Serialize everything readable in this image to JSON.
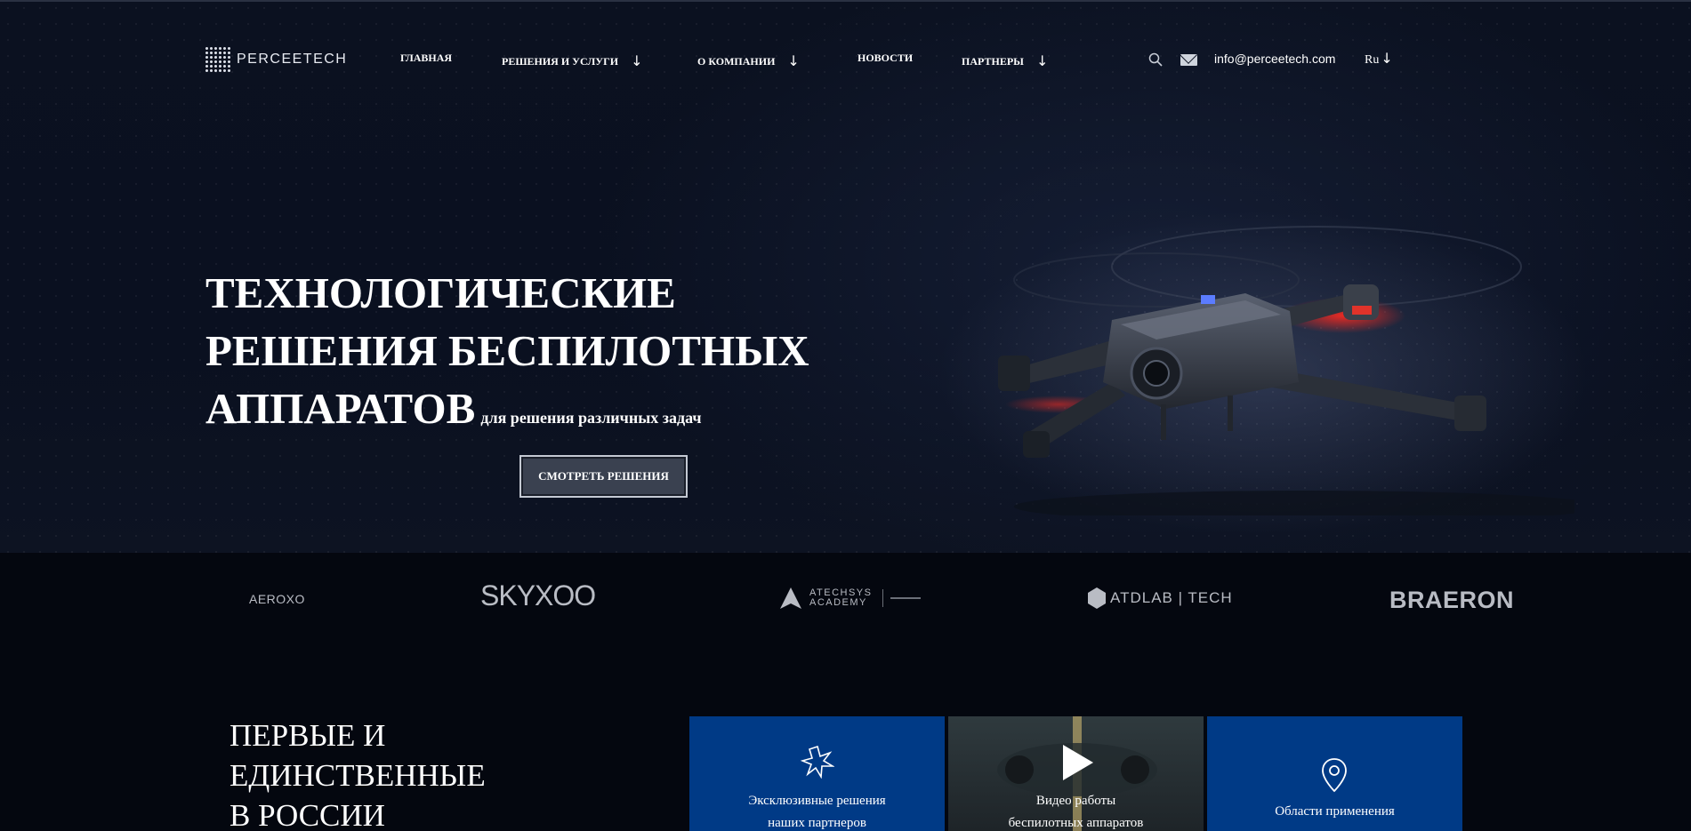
{
  "brand": {
    "name": "PERCEETECH"
  },
  "nav": {
    "items": [
      {
        "label": "ГЛАВНАЯ",
        "arrow": ""
      },
      {
        "label": "РЕШЕНИЯ И УСЛУГИ",
        "arrow": "↓"
      },
      {
        "label": "О КОМПАНИИ",
        "arrow": "↓"
      },
      {
        "label": "НОВОСТИ",
        "arrow": ""
      },
      {
        "label": "ПАРТНЕРЫ",
        "arrow": "↓"
      }
    ],
    "email": "info@perceetech.com",
    "language": "Ru",
    "language_arrow": "↓"
  },
  "hero": {
    "title_line1": "ТЕХНОЛОГИЧЕСКИЕ",
    "title_line2": "РЕШЕНИЯ БЕСПИЛОТНЫХ",
    "title_line3": "АППАРАТОВ",
    "subtitle": "для решения различных задач",
    "cta_label": "СМОТРЕТЬ РЕШЕНИЯ"
  },
  "partners": [
    {
      "name": "AEROXO"
    },
    {
      "name": "SKYXOO"
    },
    {
      "name": "ATECHSYS ACADEMY"
    },
    {
      "name": "ATDLAB | TECH"
    },
    {
      "name": "BRAERON"
    }
  ],
  "about": {
    "line1": "ПЕРВЫЕ И",
    "line2": "ЕДИНСТВЕННЫЕ",
    "line3": "В РОССИИ"
  },
  "cards": [
    {
      "line1": "Эксклюзивные решения",
      "line2": "наших партнеров",
      "icon": "sparkle-icon"
    },
    {
      "line1": "Видео работы",
      "line2": "беспилотных аппаратов",
      "icon": "play-icon"
    },
    {
      "line1": "Области применения",
      "line2": "",
      "icon": "map-pin-icon"
    }
  ],
  "colors": {
    "card_blue": "#003a86",
    "background": "#04070f",
    "accent_red": "#e0332a"
  }
}
